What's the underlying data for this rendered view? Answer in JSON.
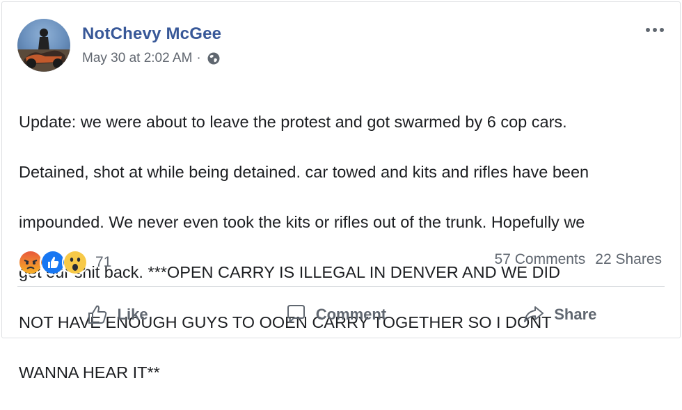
{
  "post": {
    "author": "NotChevy McGee",
    "timestamp": "May 30 at 2:02 AM",
    "separator": "·",
    "privacy_icon": "globe-icon",
    "body_lines": [
      "Update: we were about to leave the protest and got swarmed by 6 cop cars.",
      "Detained, shot at while being detained. car towed and kits and rifles have been",
      "impounded. We never even took the kits or rifles out of the trunk. Hopefully we",
      "get our shit back. ***OPEN CARRY IS ILLEGAL IN DENVER AND WE DID",
      "NOT HAVE ENOUGH GUYS TO OOEN CARRY TOGETHER SO I DONT",
      "WANNA HEAR IT**"
    ]
  },
  "reactions": {
    "icons": [
      "angry-reaction-icon",
      "like-reaction-icon",
      "wow-reaction-icon"
    ],
    "count": "71"
  },
  "stats": {
    "comments": "57 Comments",
    "shares": "22 Shares"
  },
  "actions": {
    "like": "Like",
    "comment": "Comment",
    "share": "Share"
  },
  "colors": {
    "author": "#385898",
    "meta": "#616770",
    "text": "#1c1e21",
    "divider": "#dadde1"
  }
}
